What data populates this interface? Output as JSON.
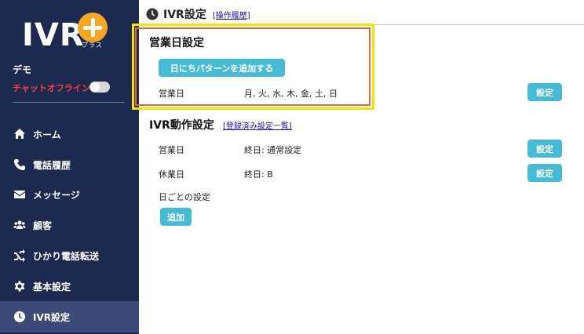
{
  "sidebar": {
    "logo_text": "IVR",
    "logo_sub": "プラス",
    "user_name": "デモ",
    "chat_status": "チャットオフライン",
    "items": [
      {
        "label": "ホーム",
        "icon": "home-icon"
      },
      {
        "label": "電話履歴",
        "icon": "phone-icon"
      },
      {
        "label": "メッセージ",
        "icon": "envelope-icon"
      },
      {
        "label": "顧客",
        "icon": "users-icon"
      },
      {
        "label": "ひかり電話転送",
        "icon": "shuffle-icon"
      },
      {
        "label": "基本設定",
        "icon": "gear-icon"
      },
      {
        "label": "IVR設定",
        "icon": "clock-icon",
        "active": true
      }
    ]
  },
  "header": {
    "title": "IVR設定",
    "history_link": "[操作履歴]"
  },
  "business_days": {
    "title": "営業日設定",
    "add_button": "日にちパターンを追加する",
    "row_label": "営業日",
    "row_value": "月, 火, 水, 木, 金, 土, 日",
    "setting_button": "設定"
  },
  "ivr_actions": {
    "title": "IVR動作設定",
    "list_link": "[登録済み設定一覧]",
    "rows": [
      {
        "label": "営業日",
        "value": "終日: 通常設定",
        "button": "設定"
      },
      {
        "label": "休業日",
        "value": "終日: B",
        "button": "設定"
      }
    ],
    "daily_label": "日ごとの設定",
    "add_button": "追加"
  }
}
